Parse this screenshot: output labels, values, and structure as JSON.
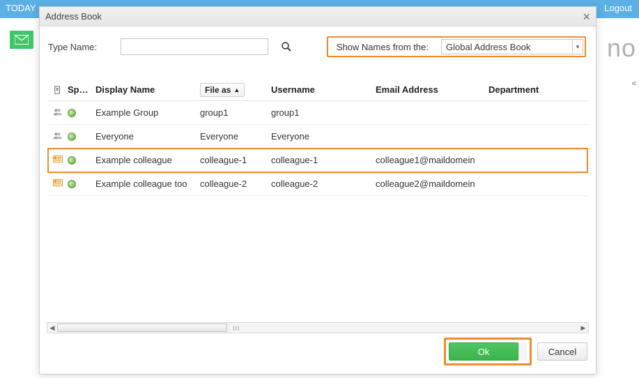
{
  "topbar": {
    "left": "TODAY",
    "right": "Logout",
    "brand_fragment": "no"
  },
  "modal": {
    "title": "Address Book",
    "type_label": "Type Name:",
    "type_value": "",
    "show_label": "Show Names from the:",
    "show_value": "Global Address Book",
    "headers": {
      "speed": "Sp…",
      "display": "Display Name",
      "file_as": "File as",
      "username": "Username",
      "email": "Email Address",
      "department": "Department"
    },
    "rows": [
      {
        "type": "group",
        "display": "Example Group",
        "file": "group1",
        "user": "group1",
        "email": "",
        "dept": ""
      },
      {
        "type": "group",
        "display": "Everyone",
        "file": "Everyone",
        "user": "Everyone",
        "email": "",
        "dept": ""
      },
      {
        "type": "contact",
        "display": "Example colleague",
        "file": "colleague-1",
        "user": "colleague-1",
        "email": "colleague1@maildomein",
        "dept": "",
        "highlight": true
      },
      {
        "type": "contact",
        "display": "Example colleague too",
        "file": "colleague-2",
        "user": "colleague-2",
        "email": "colleague2@maildomein",
        "dept": ""
      }
    ],
    "ok": "Ok",
    "cancel": "Cancel"
  }
}
